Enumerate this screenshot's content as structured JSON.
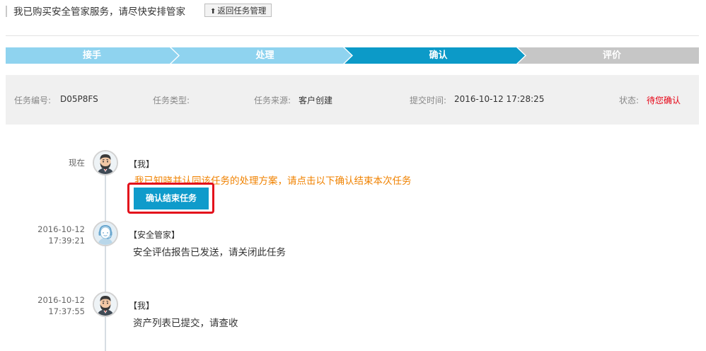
{
  "header": {
    "title": "我已购买安全管家服务，请尽快安排管家",
    "back_label": "返回任务管理"
  },
  "steps": [
    {
      "label": "接手",
      "state": "done"
    },
    {
      "label": "处理",
      "state": "done"
    },
    {
      "label": "确认",
      "state": "current"
    },
    {
      "label": "评价",
      "state": "todo"
    }
  ],
  "colors": {
    "step_done": "#8fd3ef",
    "step_current": "#0c9ac8",
    "step_todo": "#c6c6c6",
    "status_red": "#e60012",
    "prompt_orange": "#f08200",
    "button_blue": "#0f9bcb"
  },
  "info": {
    "task_no_label": "任务编号:",
    "task_no": "D05P8FS",
    "task_type_label": "任务类型:",
    "task_type": "",
    "source_label": "任务来源:",
    "source": "客户创建",
    "submit_time_label": "提交时间:",
    "submit_time": "2016-10-12 17:28:25",
    "status_label": "状态:",
    "status": "待您确认"
  },
  "timeline": [
    {
      "time": "现在",
      "avatar": "bearded-man-avatar",
      "who": "【我】",
      "message": "我已知晓并认同该任务的处理方案，请点击以下确认结束本次任务",
      "button": "确认结束任务"
    },
    {
      "date": "2016-10-12",
      "clock": "17:39:21",
      "avatar": "support-agent-avatar",
      "who": "【安全管家】",
      "message": "安全评估报告已发送，请关闭此任务"
    },
    {
      "date": "2016-10-12",
      "clock": "17:37:55",
      "avatar": "bearded-man-avatar",
      "who": "【我】",
      "message": "资产列表已提交，请查收"
    }
  ]
}
